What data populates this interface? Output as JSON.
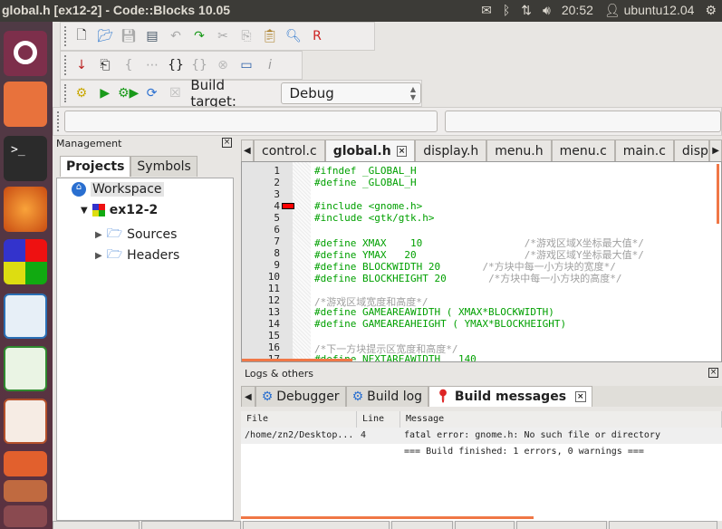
{
  "window": {
    "title": "global.h [ex12-2] - Code::Blocks 10.05"
  },
  "tray": {
    "time": "20:52",
    "user": "ubuntu12.04",
    "icons": [
      "mail-icon",
      "bluetooth-icon",
      "network-icon",
      "volume-icon",
      "user-icon",
      "power-icon"
    ]
  },
  "launcher": [
    "ubuntu-dash",
    "files",
    "terminal",
    "firefox",
    "codeblocks",
    "libreoffice-writer",
    "libreoffice-calc",
    "libreoffice-impress",
    "ubuntu-software-center",
    "update-manager",
    "system-settings"
  ],
  "toolbar": {
    "build_target_label": "Build target:",
    "build_target_value": "Debug"
  },
  "management": {
    "title": "Management",
    "tabs": [
      "Projects",
      "Symbols"
    ],
    "tree": {
      "workspace": "Workspace",
      "project": "ex12-2",
      "folders": [
        "Sources",
        "Headers"
      ]
    }
  },
  "editor": {
    "tabs": [
      "control.c",
      "global.h",
      "display.h",
      "menu.h",
      "menu.c",
      "main.c",
      "displa"
    ],
    "active_tab": "global.h",
    "lines": [
      {
        "n": "1",
        "code": "#ifndef _GLOBAL_H",
        "comment": ""
      },
      {
        "n": "2",
        "code": "#define _GLOBAL_H",
        "comment": ""
      },
      {
        "n": "3",
        "code": "",
        "comment": ""
      },
      {
        "n": "4",
        "code": "#include <gnome.h>",
        "comment": "",
        "error": true
      },
      {
        "n": "5",
        "code": "#include <gtk/gtk.h>",
        "comment": ""
      },
      {
        "n": "6",
        "code": "",
        "comment": ""
      },
      {
        "n": "7",
        "code": "#define XMAX    10                 ",
        "comment": "/*游戏区域X坐标最大值*/"
      },
      {
        "n": "8",
        "code": "#define YMAX   20                  ",
        "comment": "/*游戏区域Y坐标最大值*/"
      },
      {
        "n": "9",
        "code": "#define BLOCKWIDTH 20       ",
        "comment": "/*方块中每一小方块的宽度*/"
      },
      {
        "n": "10",
        "code": "#define BLOCKHEIGHT 20       ",
        "comment": "/*方块中每一小方块的高度*/"
      },
      {
        "n": "11",
        "code": "",
        "comment": ""
      },
      {
        "n": "12",
        "code": "",
        "comment": "/*游戏区域宽度和高度*/"
      },
      {
        "n": "13",
        "code": "#define GAMEAREAWIDTH ( XMAX*BLOCKWIDTH)",
        "comment": ""
      },
      {
        "n": "14",
        "code": "#define GAMEAREAHEIGHT ( YMAX*BLOCKHEIGHT)",
        "comment": ""
      },
      {
        "n": "15",
        "code": "",
        "comment": ""
      },
      {
        "n": "16",
        "code": "",
        "comment": "/*下一方块提示区宽度和高度*/"
      },
      {
        "n": "17",
        "code": "#define NEXTAREAWIDTH   140",
        "comment": ""
      }
    ]
  },
  "logs": {
    "title": "Logs & others",
    "tabs": [
      "Debugger",
      "Build log",
      "Build messages"
    ],
    "active_tab": "Build messages",
    "columns": [
      "File",
      "Line",
      "Message"
    ],
    "rows": [
      {
        "file": "/home/zn2/Desktop...",
        "line": "4",
        "message": "fatal error: gnome.h: No such file or directory"
      },
      {
        "file": "",
        "line": "",
        "message": "=== Build finished: 1 errors, 0 warnings ==="
      }
    ]
  },
  "colors": {
    "accent": "#f07746",
    "code": "#00a000",
    "comment": "#a0a0a0",
    "error_marker": "#ff0000"
  }
}
